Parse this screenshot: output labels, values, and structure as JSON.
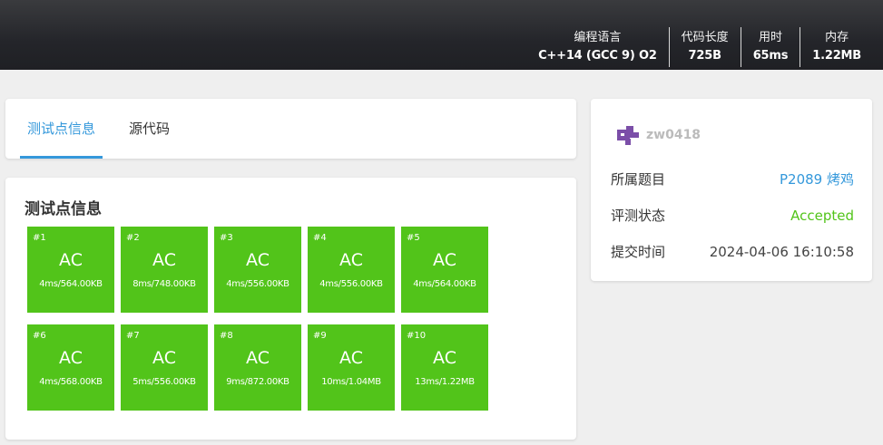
{
  "header": {
    "stats": [
      {
        "label": "编程语言",
        "value": "C++14 (GCC 9) O2"
      },
      {
        "label": "代码长度",
        "value": "725B"
      },
      {
        "label": "用时",
        "value": "65ms"
      },
      {
        "label": "内存",
        "value": "1.22MB"
      }
    ]
  },
  "tabs": [
    {
      "label": "测试点信息",
      "active": true
    },
    {
      "label": "源代码",
      "active": false
    }
  ],
  "tests": {
    "title": "测试点信息",
    "cases": [
      {
        "id": "#1",
        "status": "AC",
        "meta": "4ms/564.00KB"
      },
      {
        "id": "#2",
        "status": "AC",
        "meta": "8ms/748.00KB"
      },
      {
        "id": "#3",
        "status": "AC",
        "meta": "4ms/556.00KB"
      },
      {
        "id": "#4",
        "status": "AC",
        "meta": "4ms/556.00KB"
      },
      {
        "id": "#5",
        "status": "AC",
        "meta": "4ms/564.00KB"
      },
      {
        "id": "#6",
        "status": "AC",
        "meta": "4ms/568.00KB"
      },
      {
        "id": "#7",
        "status": "AC",
        "meta": "5ms/556.00KB"
      },
      {
        "id": "#8",
        "status": "AC",
        "meta": "9ms/872.00KB"
      },
      {
        "id": "#9",
        "status": "AC",
        "meta": "10ms/1.04MB"
      },
      {
        "id": "#10",
        "status": "AC",
        "meta": "13ms/1.22MB"
      }
    ]
  },
  "info": {
    "username": "zw0418",
    "avatar_icon": "purple-avatar-icon",
    "problem_label": "所属题目",
    "problem_value": "P2089 烤鸡",
    "status_label": "评测状态",
    "status_value": "Accepted",
    "time_label": "提交时间",
    "time_value": "2024-04-06 16:10:58"
  },
  "colors": {
    "accent": "#3498db",
    "ac_green": "#52c41a",
    "avatar_purple": "#7b4ea8"
  }
}
